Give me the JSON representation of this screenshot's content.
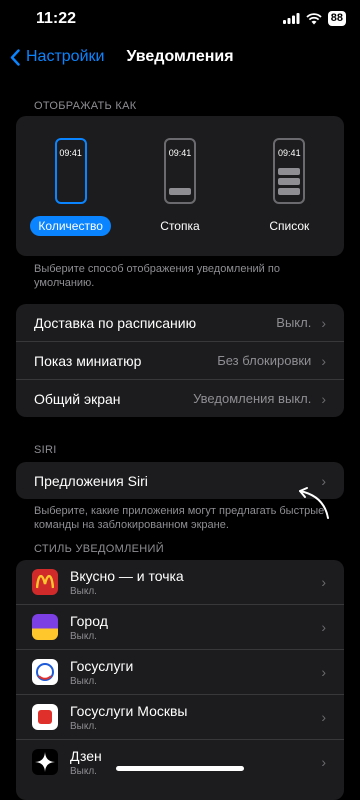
{
  "status": {
    "time": "11:22",
    "battery": "88"
  },
  "nav": {
    "back_label": "Настройки",
    "title": "Уведомления"
  },
  "display": {
    "header": "ОТОБРАЖАТЬ КАК",
    "options": [
      {
        "label": "Количество",
        "time": "09:41",
        "selected": true
      },
      {
        "label": "Стопка",
        "time": "09:41"
      },
      {
        "label": "Список",
        "time": "09:41"
      }
    ],
    "footnote": "Выберите способ отображения уведомлений по умолчанию."
  },
  "settings": [
    {
      "label": "Доставка по расписанию",
      "value": "Выкл."
    },
    {
      "label": "Показ миниатюр",
      "value": "Без блокировки"
    },
    {
      "label": "Общий экран",
      "value": "Уведомления выкл."
    }
  ],
  "siri": {
    "header": "SIRI",
    "suggestions_label": "Предложения Siri",
    "footnote": "Выберите, какие приложения могут предлагать быстрые команды на заблокированном экране."
  },
  "apps_header": "СТИЛЬ УВЕДОМЛЕНИЙ",
  "apps": [
    {
      "name": "Вкусно — и точка",
      "status": "Выкл.",
      "icon": "vkusno-icon",
      "color": "#d12a2a"
    },
    {
      "name": "Город",
      "status": "Выкл.",
      "icon": "gorod-icon",
      "color": "#7b3fe4"
    },
    {
      "name": "Госуслуги",
      "status": "Выкл.",
      "icon": "gosuslugi-icon",
      "color": "#ffffff"
    },
    {
      "name": "Госуслуги  Москвы",
      "status": "Выкл.",
      "icon": "gosuslugi-moskvy-icon",
      "color": "#ffffff"
    },
    {
      "name": "Дзен",
      "status": "Выкл.",
      "icon": "dzen-icon",
      "color": "#000000"
    }
  ],
  "accent_color": "#0a84ff"
}
